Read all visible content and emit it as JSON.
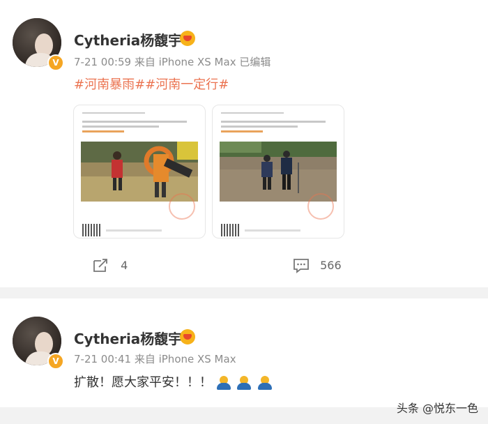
{
  "posts": [
    {
      "username": "Cytheria杨馥宇",
      "time": "7-21 00:59",
      "source": "来自 iPhone XS Max",
      "edited": "已编辑",
      "tags": "#河南暴雨##河南一定行#",
      "repost_count": "4",
      "comment_count": "566"
    },
    {
      "username": "Cytheria杨馥宇",
      "time": "7-21 00:41",
      "source": "来自 iPhone XS Max",
      "text": "扩散！愿大家平安！！！"
    }
  ],
  "watermark": "头条 @悦东一色",
  "icons": [
    "verified-badge-icon",
    "member-crown-icon",
    "repost-icon",
    "comment-icon",
    "pray-emoji-icon"
  ],
  "colors": {
    "tag": "#eb7350",
    "badge": "#f5a623",
    "meta": "#8b8b8b",
    "separator": "#f2f2f2"
  }
}
